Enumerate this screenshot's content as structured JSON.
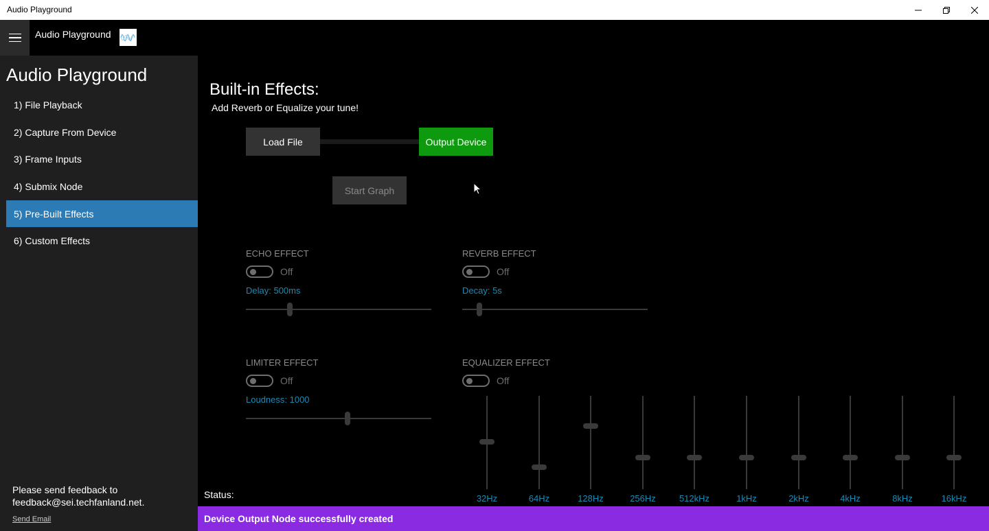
{
  "window": {
    "title": "Audio Playground"
  },
  "topbar": {
    "app_title": "Audio Playground"
  },
  "sidebar": {
    "heading": "Audio Playground",
    "items": [
      {
        "label": "1) File Playback",
        "active": false
      },
      {
        "label": "2) Capture From Device",
        "active": false
      },
      {
        "label": "3) Frame Inputs",
        "active": false
      },
      {
        "label": "4) Submix Node",
        "active": false
      },
      {
        "label": "5) Pre-Built Effects",
        "active": true
      },
      {
        "label": "6) Custom Effects",
        "active": false
      }
    ],
    "feedback_line1": "Please send feedback to",
    "feedback_line2": "feedback@sei.techfanland.net.",
    "send_email": "Send Email"
  },
  "main": {
    "title": "Built-in Effects:",
    "subtitle": "Add Reverb or Equalize your tune!",
    "load_file": "Load File",
    "output_device": "Output Device",
    "start_graph": "Start Graph"
  },
  "effects": {
    "echo": {
      "label": "ECHO EFFECT",
      "state": "Off",
      "param": "Delay: 500ms",
      "level": 0.23
    },
    "reverb": {
      "label": "REVERB EFFECT",
      "state": "Off",
      "param": "Decay: 5s",
      "level": 0.08
    },
    "limiter": {
      "label": "LIMITER EFFECT",
      "state": "Off",
      "param": "Loudness: 1000",
      "level": 0.55
    },
    "equalizer": {
      "label": "EQUALIZER EFFECT",
      "state": "Off"
    }
  },
  "equalizer_bands": [
    {
      "label": "32Hz",
      "level": 0.51
    },
    {
      "label": "64Hz",
      "level": 0.22
    },
    {
      "label": "128Hz",
      "level": 0.69
    },
    {
      "label": "256Hz",
      "level": 0.33
    },
    {
      "label": "512kHz",
      "level": 0.33
    },
    {
      "label": "1kHz",
      "level": 0.33
    },
    {
      "label": "2kHz",
      "level": 0.33
    },
    {
      "label": "4kHz",
      "level": 0.33
    },
    {
      "label": "8kHz",
      "level": 0.33
    },
    {
      "label": "16kHz",
      "level": 0.33
    }
  ],
  "status": {
    "label": "Status:",
    "message": "Device Output Node successfully created"
  },
  "colors": {
    "accent_nav": "#2c7bb4",
    "output_device": "#0e9a0e",
    "status_bar": "#8a2be2",
    "param_text": "#1a8bb5"
  }
}
